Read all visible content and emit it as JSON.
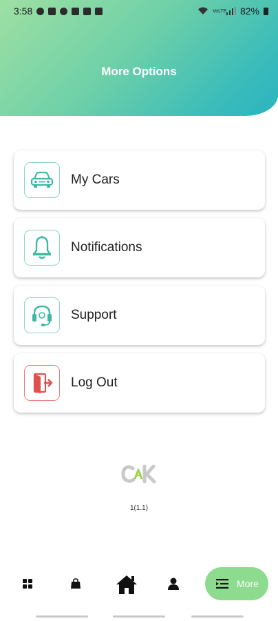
{
  "status_bar": {
    "time": "3:58",
    "battery": "82%",
    "network_label": "VoLTE"
  },
  "header": {
    "title": "More Options",
    "gradient_colors": [
      "#9ee0a3",
      "#2ab3c0"
    ]
  },
  "menu": {
    "items": [
      {
        "label": "My Cars",
        "icon": "car-icon"
      },
      {
        "label": "Notifications",
        "icon": "bell-icon"
      },
      {
        "label": "Support",
        "icon": "headset-icon"
      },
      {
        "label": "Log Out",
        "icon": "logout-door-icon"
      }
    ],
    "accent_color": "#3fb9a6",
    "danger_color": "#e0514f"
  },
  "footer": {
    "logo_text": "CAK",
    "version": "1(1.1)"
  },
  "bottom_nav": {
    "items": [
      {
        "icon": "grid-icon"
      },
      {
        "icon": "shopping-bag-icon"
      },
      {
        "icon": "home-icon"
      },
      {
        "icon": "user-icon"
      }
    ],
    "active": {
      "label": "More",
      "icon": "menu-list-icon",
      "color": "#8ddb8f"
    }
  }
}
